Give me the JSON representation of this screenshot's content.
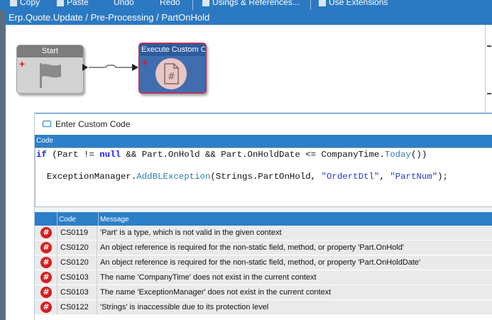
{
  "toolbar": {
    "items": [
      {
        "label": "Copy"
      },
      {
        "label": "Paste"
      },
      {
        "label": "Undo"
      },
      {
        "label": "Redo"
      },
      {
        "label": "Usings & References..."
      },
      {
        "label": "Use Extensions"
      }
    ]
  },
  "breadcrumb": {
    "text": "Erp.Quote.Update / Pre-Processing / PartOnHold"
  },
  "canvas": {
    "start_node": {
      "label": "Start"
    },
    "exec_node": {
      "label": "Execute Custom Code"
    }
  },
  "dialog": {
    "title": "Enter Custom Code",
    "code_label": "Code",
    "code_lines": {
      "l1_kw_if": "if",
      "l1_a": " (Part != ",
      "l1_kw_null": "null",
      "l1_b": " && Part.OnHold && Part.OnHoldDate <= CompanyTime.",
      "l1_today": "Today",
      "l1_c": "())",
      "l2_a": "  ExceptionManager.",
      "l2_method": "AddBLException",
      "l2_b": "(Strings.PartOnHold, ",
      "l2_str1": "\"OrdertDtl\"",
      "l2_c": ", ",
      "l2_str2": "\"PartNum\"",
      "l2_d": ");"
    },
    "errors": {
      "columns": {
        "code": "Code",
        "message": "Message"
      },
      "rows": [
        {
          "code": "CS0119",
          "message": "'Part' is a type, which is not valid in the given context"
        },
        {
          "code": "CS0120",
          "message": "An object reference is required for the non-static field, method, or property 'Part.OnHold'"
        },
        {
          "code": "CS0120",
          "message": "An object reference is required for the non-static field, method, or property 'Part.OnHoldDate'"
        },
        {
          "code": "CS0103",
          "message": "The name 'CompanyTime' does not exist in the current context"
        },
        {
          "code": "CS0103",
          "message": "The name 'ExceptionManager' does not exist in the current context"
        },
        {
          "code": "CS0122",
          "message": "'Strings' is inaccessible due to its protection level"
        }
      ],
      "icon_glyph": "#"
    }
  },
  "colors": {
    "accent": "#2b79c2",
    "error": "#d91c1c"
  }
}
